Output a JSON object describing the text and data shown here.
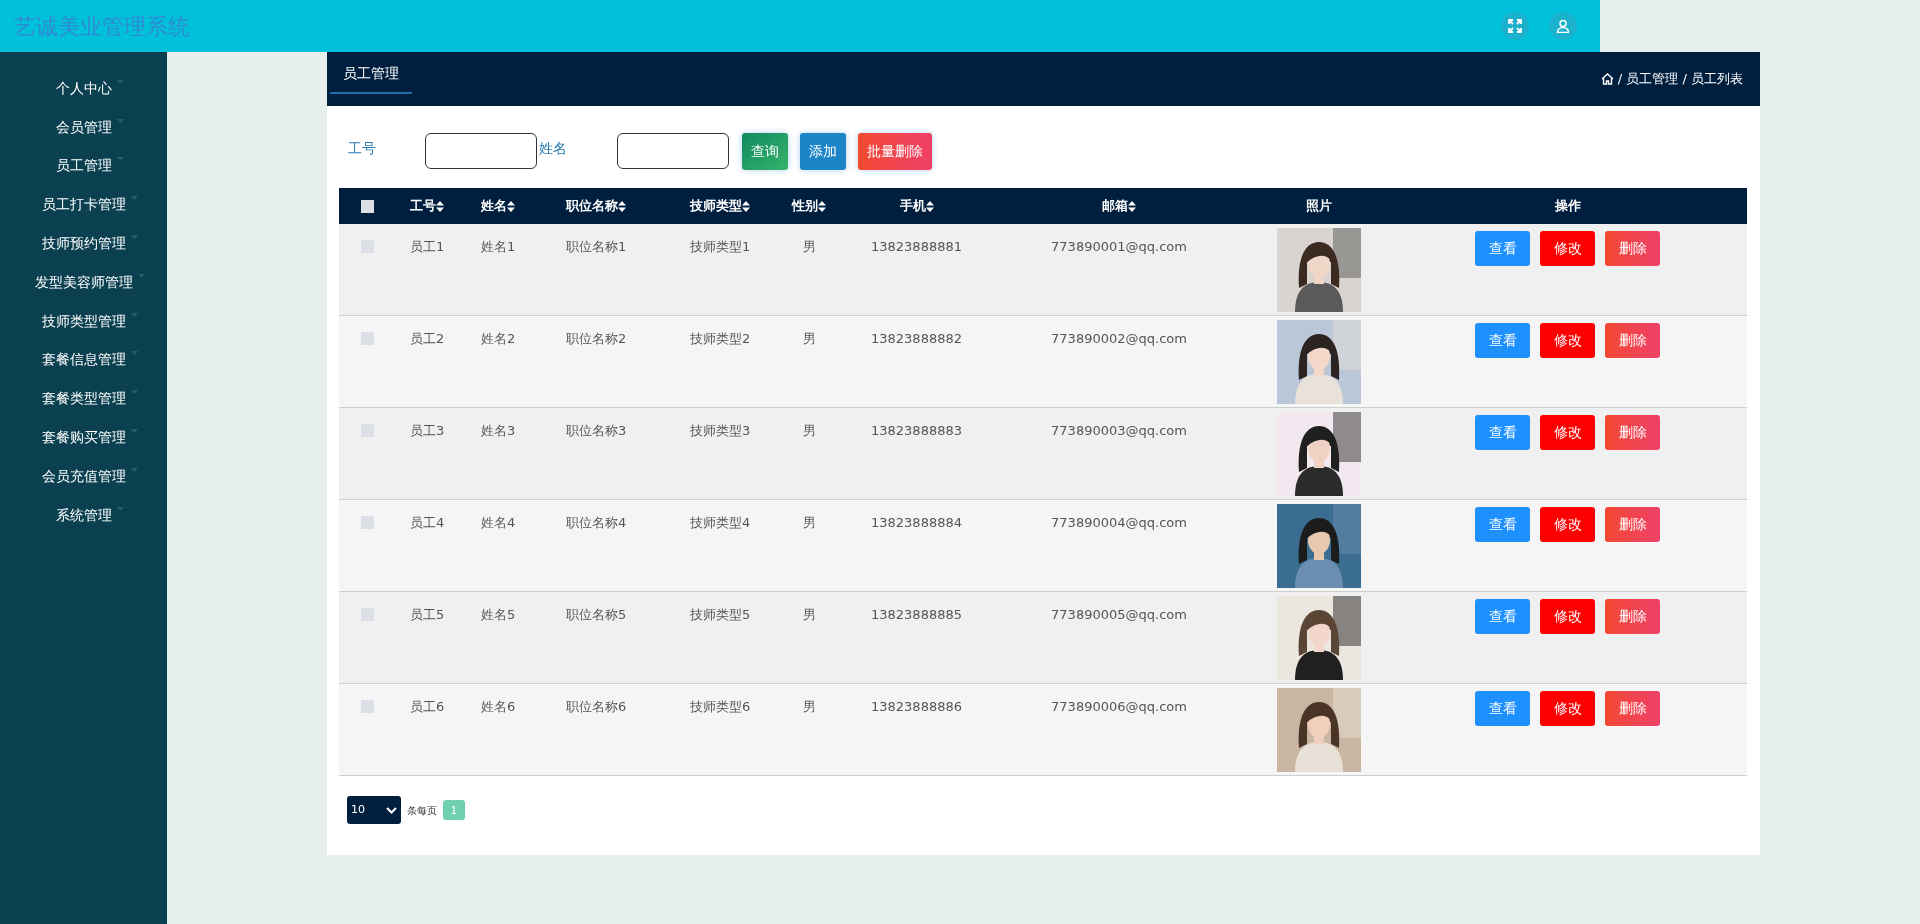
{
  "header": {
    "title": "艺诚美业管理系统"
  },
  "sidebar": {
    "items": [
      {
        "label": "个人中心"
      },
      {
        "label": "会员管理"
      },
      {
        "label": "员工管理"
      },
      {
        "label": "员工打卡管理"
      },
      {
        "label": "技师预约管理"
      },
      {
        "label": "发型美容师管理"
      },
      {
        "label": "技师类型管理"
      },
      {
        "label": "套餐信息管理"
      },
      {
        "label": "套餐类型管理"
      },
      {
        "label": "套餐购买管理"
      },
      {
        "label": "会员充值管理"
      },
      {
        "label": "系统管理"
      }
    ]
  },
  "panel": {
    "tab": "员工管理",
    "breadcrumb": "/ 员工管理 / 员工列表"
  },
  "search": {
    "fields": [
      {
        "label": "工号"
      },
      {
        "label": "姓名"
      }
    ],
    "buttons": [
      {
        "label": "查询",
        "kind": "query"
      },
      {
        "label": "添加",
        "kind": "add"
      },
      {
        "label": "批量删除",
        "kind": "delete"
      }
    ]
  },
  "table": {
    "all_checked": false,
    "columns": [
      {
        "label": "工号",
        "sortable": true
      },
      {
        "label": "姓名",
        "sortable": true
      },
      {
        "label": "职位名称",
        "sortable": true
      },
      {
        "label": "技师类型",
        "sortable": true
      },
      {
        "label": "性别",
        "sortable": true
      },
      {
        "label": "手机",
        "sortable": true
      },
      {
        "label": "邮箱",
        "sortable": true
      },
      {
        "label": "照片",
        "sortable": false
      },
      {
        "label": "操作",
        "sortable": false
      }
    ],
    "rows": [
      {
        "checked": false,
        "cells": [
          "员工1",
          "姓名1",
          "职位名称1",
          "技师类型1",
          "男",
          "13823888881",
          "773890001@qq.com"
        ],
        "actions": [
          {
            "label": "查看",
            "kind": "view"
          },
          {
            "label": "修改",
            "kind": "edit"
          },
          {
            "label": "删除",
            "kind": "delete"
          }
        ]
      },
      {
        "checked": false,
        "cells": [
          "员工2",
          "姓名2",
          "职位名称2",
          "技师类型2",
          "男",
          "13823888882",
          "773890002@qq.com"
        ],
        "actions": [
          {
            "label": "查看",
            "kind": "view"
          },
          {
            "label": "修改",
            "kind": "edit"
          },
          {
            "label": "删除",
            "kind": "delete"
          }
        ]
      },
      {
        "checked": false,
        "cells": [
          "员工3",
          "姓名3",
          "职位名称3",
          "技师类型3",
          "男",
          "13823888883",
          "773890003@qq.com"
        ],
        "actions": [
          {
            "label": "查看",
            "kind": "view"
          },
          {
            "label": "修改",
            "kind": "edit"
          },
          {
            "label": "删除",
            "kind": "delete"
          }
        ]
      },
      {
        "checked": false,
        "cells": [
          "员工4",
          "姓名4",
          "职位名称4",
          "技师类型4",
          "男",
          "13823888884",
          "773890004@qq.com"
        ],
        "actions": [
          {
            "label": "查看",
            "kind": "view"
          },
          {
            "label": "修改",
            "kind": "edit"
          },
          {
            "label": "删除",
            "kind": "delete"
          }
        ]
      },
      {
        "checked": false,
        "cells": [
          "员工5",
          "姓名5",
          "职位名称5",
          "技师类型5",
          "男",
          "13823888885",
          "773890005@qq.com"
        ],
        "actions": [
          {
            "label": "查看",
            "kind": "view"
          },
          {
            "label": "修改",
            "kind": "edit"
          },
          {
            "label": "删除",
            "kind": "delete"
          }
        ]
      },
      {
        "checked": false,
        "cells": [
          "员工6",
          "姓名6",
          "职位名称6",
          "技师类型6",
          "男",
          "13823888886",
          "773890006@qq.com"
        ],
        "actions": [
          {
            "label": "查看",
            "kind": "view"
          },
          {
            "label": "修改",
            "kind": "edit"
          },
          {
            "label": "删除",
            "kind": "delete"
          }
        ]
      }
    ]
  },
  "pagination": {
    "page_size": "10",
    "page_size_label": "条每页",
    "pages": [
      {
        "label": "1",
        "selected": true
      }
    ]
  }
}
